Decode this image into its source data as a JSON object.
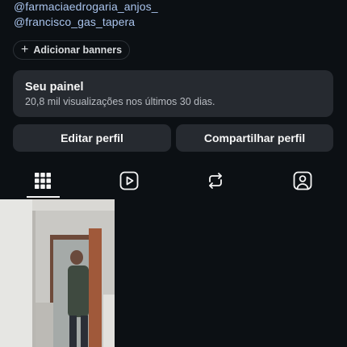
{
  "profile": {
    "mentions": [
      "@farmaciaedrogaria_anjos_",
      "@francisco_gas_tapera"
    ],
    "add_banners_label": "Adicionar banners"
  },
  "dashboard": {
    "title": "Seu painel",
    "subtitle": "20,8 mil visualizações nos últimos 30 dias."
  },
  "actions": {
    "edit_profile": "Editar perfil",
    "share_profile": "Compartilhar perfil"
  },
  "tabs": [
    {
      "icon": "grid-icon",
      "active": true
    },
    {
      "icon": "reels-icon",
      "active": false
    },
    {
      "icon": "reposts-icon",
      "active": false
    },
    {
      "icon": "tagged-icon",
      "active": false
    }
  ],
  "colors": {
    "background": "#0c1014",
    "surface": "#262a30",
    "mention": "#a9c3ec"
  }
}
